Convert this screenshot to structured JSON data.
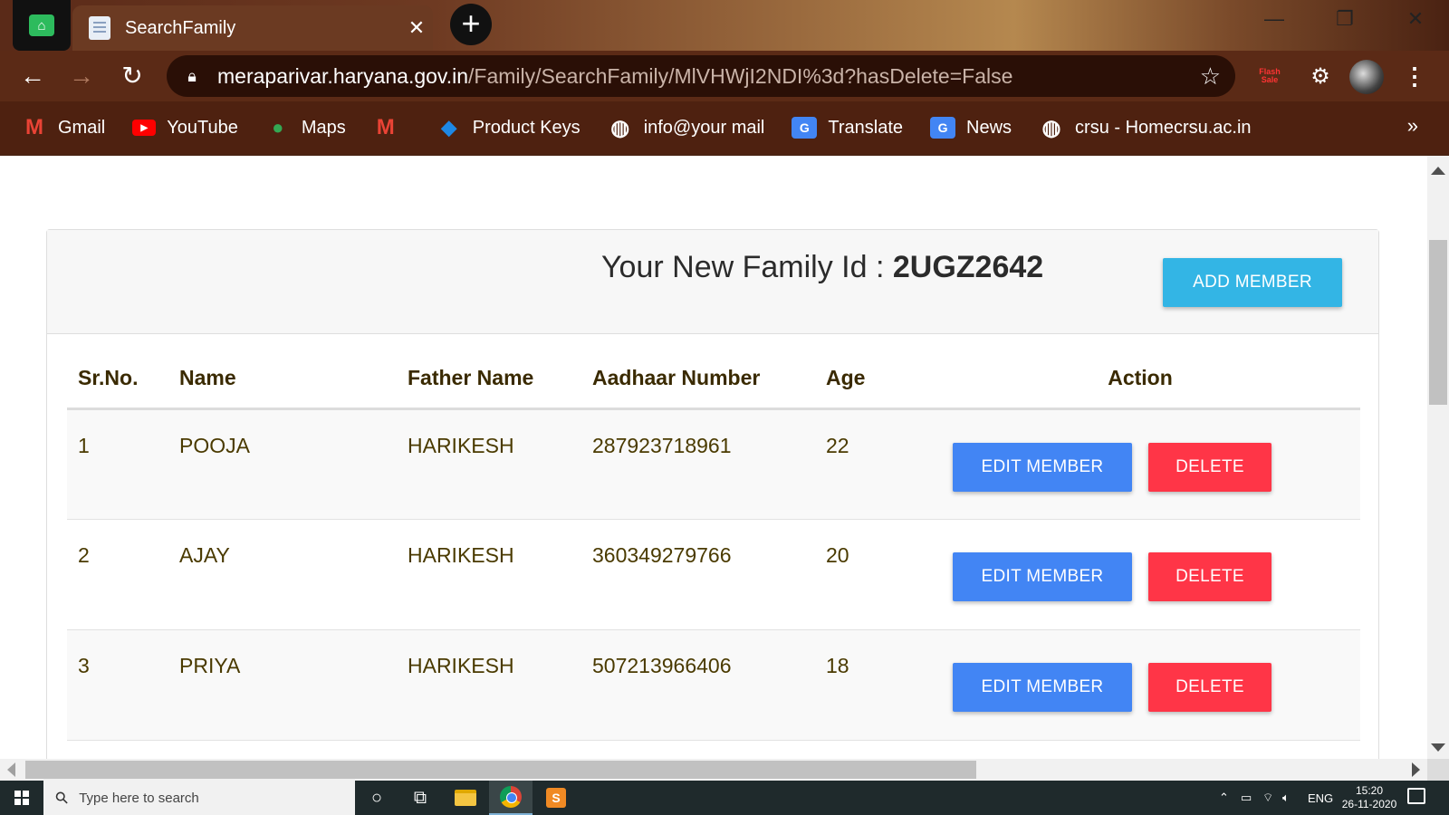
{
  "browser": {
    "tab_title": "SearchFamily",
    "tab_close": "✕",
    "new_tab": "+",
    "url_host": "meraparivar.haryana.gov.in",
    "url_path": "/Family/SearchFamily/MlVHWjI2NDI%3d?hasDelete=False",
    "flash_sale": "Flash Sale",
    "bookmarks": [
      {
        "label": "Gmail",
        "icon": "gmail-icon"
      },
      {
        "label": "YouTube",
        "icon": "youtube-icon"
      },
      {
        "label": "Maps",
        "icon": "maps-icon"
      },
      {
        "label": "",
        "icon": "gmail-icon"
      },
      {
        "label": "Product Keys",
        "icon": "product-keys-icon"
      },
      {
        "label": "info@your mail",
        "icon": "globe-icon"
      },
      {
        "label": "Translate",
        "icon": "translate-icon"
      },
      {
        "label": "News",
        "icon": "news-icon"
      },
      {
        "label": "crsu - Homecrsu.ac.in",
        "icon": "globe-icon"
      }
    ],
    "bookmarks_more": "»"
  },
  "page": {
    "family_id_label": "Your New Family Id : ",
    "family_id": "2UGZ2642",
    "add_member_label": "ADD MEMBER",
    "columns": [
      "Sr.No.",
      "Name",
      "Father Name",
      "Aadhaar Number",
      "Age",
      "Action"
    ],
    "members": [
      {
        "sr": "1",
        "name": "POOJA",
        "father": "HARIKESH",
        "aadhaar": "287923718961",
        "age": "22"
      },
      {
        "sr": "2",
        "name": "AJAY",
        "father": "HARIKESH",
        "aadhaar": "360349279766",
        "age": "20"
      },
      {
        "sr": "3",
        "name": "PRIYA",
        "father": "HARIKESH",
        "aadhaar": "507213966406",
        "age": "18"
      }
    ],
    "edit_label": "EDIT MEMBER",
    "delete_label": "DELETE"
  },
  "taskbar": {
    "search_placeholder": "Type here to search",
    "lang": "ENG",
    "time": "15:20",
    "date": "26-11-2020"
  },
  "colors": {
    "add_button": "#33b5e5",
    "edit_button": "#4285f4",
    "delete_button": "#ff3547"
  }
}
